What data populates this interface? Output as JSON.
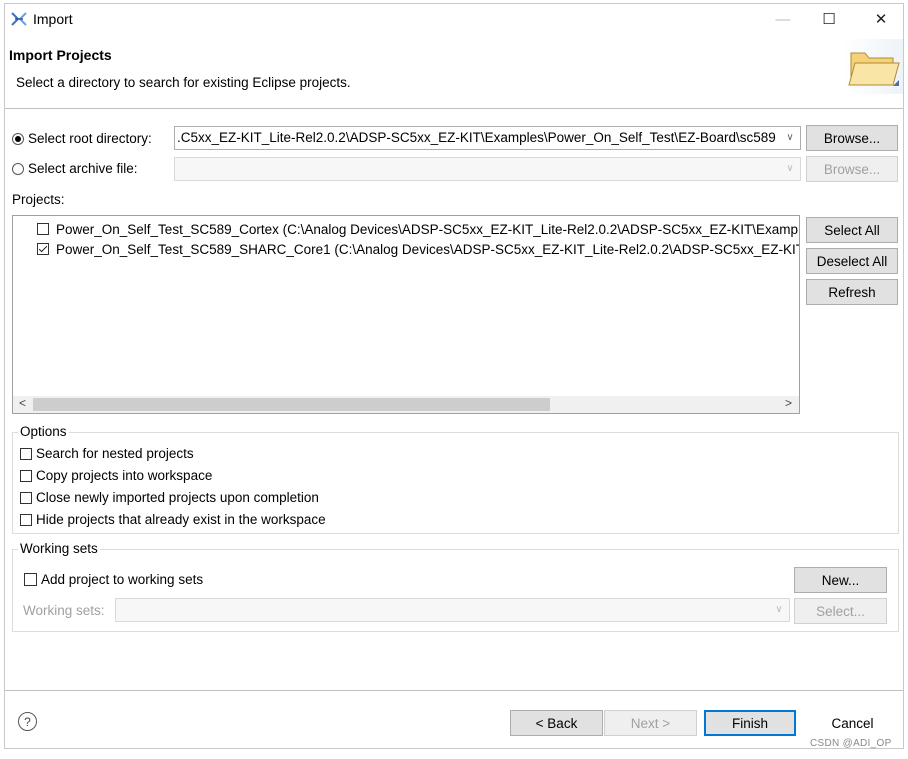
{
  "window": {
    "title": "Import",
    "minimize": "—",
    "maximize": "☐",
    "close": "✕"
  },
  "header": {
    "title": "Import Projects",
    "subtitle": "Select a directory to search for existing Eclipse projects."
  },
  "source": {
    "root_label": "Select root directory:",
    "root_value": ".C5xx_EZ-KIT_Lite-Rel2.0.2\\ADSP-SC5xx_EZ-KIT\\Examples\\Power_On_Self_Test\\EZ-Board\\sc589",
    "root_selected": true,
    "archive_label": "Select archive file:",
    "archive_value": "",
    "archive_selected": false,
    "browse_label": "Browse...",
    "browse_archive_label": "Browse..."
  },
  "projects": {
    "label": "Projects:",
    "items": [
      {
        "text": "Power_On_Self_Test_SC589_Cortex (C:\\Analog Devices\\ADSP-SC5xx_EZ-KIT_Lite-Rel2.0.2\\ADSP-SC5xx_EZ-KIT\\Examp",
        "checked": false
      },
      {
        "text": "Power_On_Self_Test_SC589_SHARC_Core1 (C:\\Analog Devices\\ADSP-SC5xx_EZ-KIT_Lite-Rel2.0.2\\ADSP-SC5xx_EZ-KIT",
        "checked": true
      }
    ],
    "select_all": "Select All",
    "deselect_all": "Deselect All",
    "refresh": "Refresh",
    "scroll_left": "<",
    "scroll_right": ">"
  },
  "options": {
    "label": "Options",
    "items": [
      {
        "text": "Search for nested projects",
        "checked": false
      },
      {
        "text": "Copy projects into workspace",
        "checked": false
      },
      {
        "text": "Close newly imported projects upon completion",
        "checked": false
      },
      {
        "text": "Hide projects that already exist in the workspace",
        "checked": false
      }
    ]
  },
  "working_sets": {
    "label": "Working sets",
    "add_label": "Add project to working sets",
    "add_checked": false,
    "sets_label": "Working sets:",
    "new_label": "New...",
    "select_label": "Select..."
  },
  "footer": {
    "help": "?",
    "back": "< Back",
    "next": "Next >",
    "finish": "Finish",
    "cancel": "Cancel"
  },
  "watermark": "CSDN @ADI_OP"
}
